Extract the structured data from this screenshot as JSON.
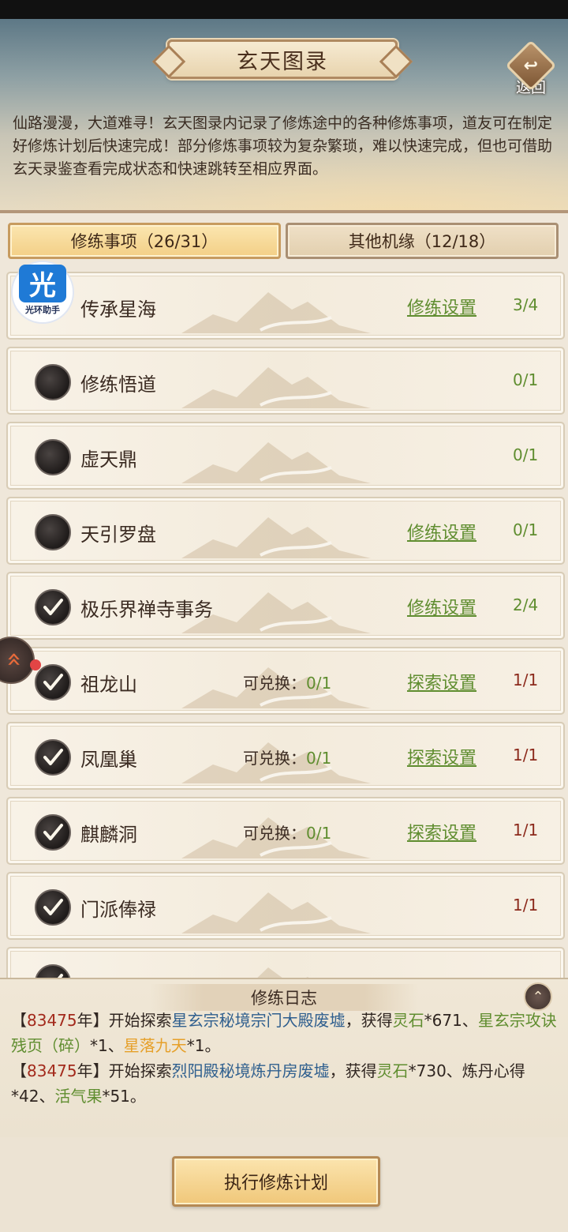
{
  "header": {
    "title": "玄天图录",
    "back_label": "返回",
    "intro": "仙路漫漫，大道难寻！玄天图录内记录了修炼途中的各种修炼事项，道友可在制定好修炼计划后快速完成！部分修炼事项较为复杂繁琐，难以快速完成，但也可借助玄天录鉴查看完成状态和快速跳转至相应界面。"
  },
  "tabs": [
    {
      "label": "修练事项（26/31）",
      "active": true
    },
    {
      "label": "其他机缘（12/18）",
      "active": false
    }
  ],
  "overlay_badge": {
    "glyph": "光",
    "label": "光环助手"
  },
  "rows": [
    {
      "name": "传承星海",
      "status": "none",
      "exchange": "",
      "link": "修练设置",
      "count": "3/4",
      "count_color": "green"
    },
    {
      "name": "修练悟道",
      "status": "empty",
      "exchange": "",
      "link": "",
      "count": "0/1",
      "count_color": "green"
    },
    {
      "name": "虚天鼎",
      "status": "empty",
      "exchange": "",
      "link": "",
      "count": "0/1",
      "count_color": "green"
    },
    {
      "name": "天引罗盘",
      "status": "empty",
      "exchange": "",
      "link": "修练设置",
      "count": "0/1",
      "count_color": "green"
    },
    {
      "name": "极乐界禅寺事务",
      "status": "check",
      "exchange": "",
      "link": "修练设置",
      "count": "2/4",
      "count_color": "green"
    },
    {
      "name": "祖龙山",
      "status": "check",
      "exchange_label": "可兑换：",
      "exchange_value": "0/1",
      "link": "探索设置",
      "count": "1/1",
      "count_color": "red"
    },
    {
      "name": "凤凰巢",
      "status": "check",
      "exchange_label": "可兑换：",
      "exchange_value": "0/1",
      "link": "探索设置",
      "count": "1/1",
      "count_color": "red"
    },
    {
      "name": "麒麟洞",
      "status": "check",
      "exchange_label": "可兑换：",
      "exchange_value": "0/1",
      "link": "探索设置",
      "count": "1/1",
      "count_color": "red"
    },
    {
      "name": "门派俸禄",
      "status": "check",
      "exchange": "",
      "link": "",
      "count": "1/1",
      "count_color": "red"
    },
    {
      "name": "",
      "status": "check",
      "exchange": "",
      "link": "",
      "count": "",
      "count_color": "red"
    }
  ],
  "log": {
    "title": "修练日志",
    "toggle_icon": "chevron-up",
    "entries": [
      {
        "parts": [
          [
            "【",
            ""
          ],
          [
            "83475",
            "yr"
          ],
          [
            "年】开始探索",
            ""
          ],
          [
            "星玄宗秘境宗门大殿废墟",
            "loc"
          ],
          [
            "，获得",
            ""
          ],
          [
            "灵石",
            "item-g"
          ],
          [
            "*671、",
            ""
          ],
          [
            "星玄宗攻诀残页（碎）",
            "item-g"
          ],
          [
            "*1、",
            ""
          ],
          [
            "星落九天",
            "item-o"
          ],
          [
            "*1。",
            ""
          ]
        ]
      },
      {
        "parts": [
          [
            "【",
            ""
          ],
          [
            "83475",
            "yr"
          ],
          [
            "年】开始探索",
            ""
          ],
          [
            "烈阳殿秘境炼丹房废墟",
            "loc"
          ],
          [
            "，获得",
            ""
          ],
          [
            "灵石",
            "item-g"
          ],
          [
            "*730、炼丹心得*42、",
            ""
          ],
          [
            "活气果",
            "item-g"
          ],
          [
            "*51。",
            ""
          ]
        ]
      }
    ]
  },
  "execute_button": "执行修炼计划",
  "colors": {
    "accent_green": "#5f8d2f",
    "count_red": "#8c2a1c",
    "location_blue": "#2f5f8e",
    "year_red": "#a32a1c",
    "item_orange": "#e6a02a"
  }
}
